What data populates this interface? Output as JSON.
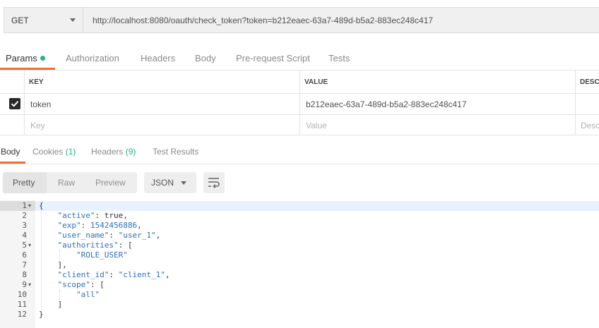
{
  "request": {
    "method": "GET",
    "url": "http://localhost:8080/oauth/check_token?token=b212eaec-63a7-489d-b5a2-883ec248c417"
  },
  "request_tabs": [
    "Params",
    "Authorization",
    "Headers",
    "Body",
    "Pre-request Script",
    "Tests"
  ],
  "params": {
    "headers": {
      "key": "KEY",
      "value": "VALUE",
      "desc": "DESCR"
    },
    "rows": [
      {
        "checked": true,
        "key": "token",
        "value": "b212eaec-63a7-489d-b5a2-883ec248c417"
      }
    ],
    "placeholders": {
      "key": "Key",
      "value": "Value",
      "desc": "Desc"
    }
  },
  "response_tabs": {
    "body": "Body",
    "cookies": "Cookies",
    "cookies_count": "(1)",
    "headers": "Headers",
    "headers_count": "(9)",
    "tests": "Test Results"
  },
  "toolbar": {
    "pretty": "Pretty",
    "raw": "Raw",
    "preview": "Preview",
    "format": "JSON"
  },
  "code": {
    "line_numbers": [
      "1",
      "2",
      "3",
      "4",
      "5",
      "6",
      "7",
      "8",
      "9",
      "10",
      "11",
      "12"
    ],
    "lines": {
      "l1": "{",
      "active_key": "\"active\"",
      "active_val": "true",
      "exp_key": "\"exp\"",
      "exp_val": "1542456886",
      "user_key": "\"user_name\"",
      "user_val": "\"user_1\"",
      "auth_key": "\"authorities\"",
      "role": "\"ROLE_USER\"",
      "close_arr": "],",
      "client_key": "\"client_id\"",
      "client_val": "\"client_1\"",
      "scope_key": "\"scope\"",
      "all": "\"all\"",
      "close_arr2": "]",
      "l12": "}"
    }
  }
}
